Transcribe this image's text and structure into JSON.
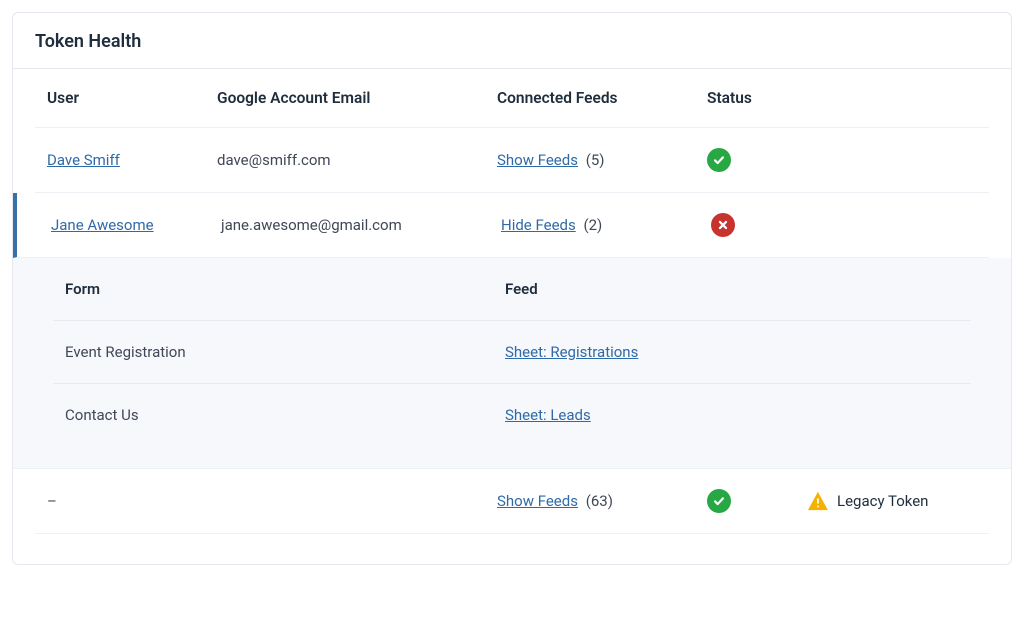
{
  "card": {
    "title": "Token Health"
  },
  "columns": {
    "user": "User",
    "email": "Google Account Email",
    "feeds": "Connected Feeds",
    "status": "Status"
  },
  "feedLabels": {
    "show": "Show Feeds",
    "hide": "Hide Feeds"
  },
  "rows": {
    "r0": {
      "user": "Dave Smiff",
      "email": "dave@smiff.com",
      "feedAction": "Show Feeds",
      "feedCount": "(5)",
      "status": "ok"
    },
    "r1": {
      "user": "Jane Awesome",
      "email": "jane.awesome@gmail.com",
      "feedAction": "Hide Feeds",
      "feedCount": "(2)",
      "status": "error"
    },
    "r2": {
      "user": "–",
      "email": "",
      "feedAction": "Show Feeds",
      "feedCount": "(63)",
      "status": "ok",
      "extra": "Legacy Token"
    }
  },
  "innerColumns": {
    "form": "Form",
    "feed": "Feed"
  },
  "innerRows": {
    "i0": {
      "form": "Event Registration",
      "feed": "Sheet: Registrations"
    },
    "i1": {
      "form": "Contact Us",
      "feed": "Sheet: Leads"
    }
  }
}
